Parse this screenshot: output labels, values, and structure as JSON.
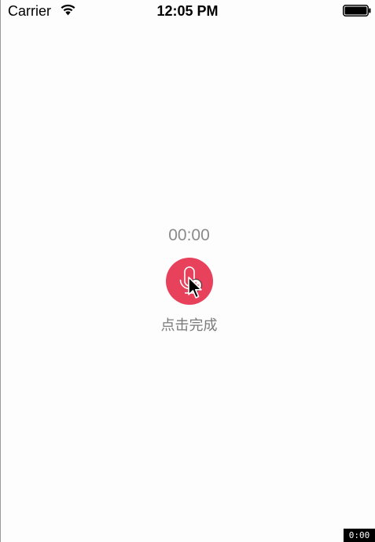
{
  "status_bar": {
    "carrier": "Carrier",
    "time": "12:05 PM",
    "wifi_icon": "wifi-icon",
    "battery_icon": "battery-icon"
  },
  "recorder": {
    "elapsed": "00:00",
    "action_hint": "点击完成",
    "button_icon": "microphone-icon",
    "button_color": "#e8415c"
  },
  "overlay": {
    "timestamp": "0:00"
  }
}
